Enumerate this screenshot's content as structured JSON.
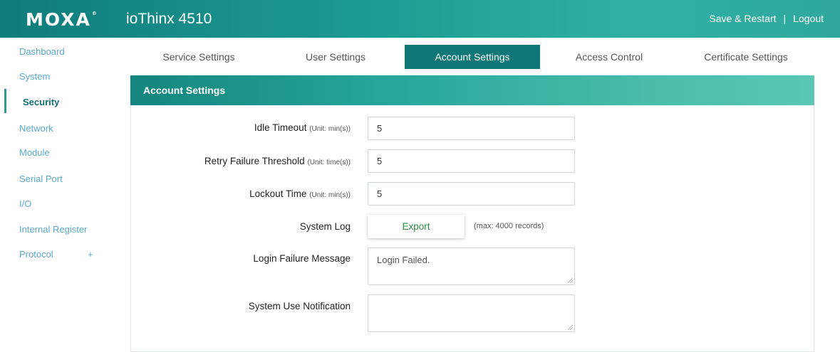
{
  "header": {
    "brand": "MOXA",
    "product": "ioThinx 4510",
    "save_restart": "Save & Restart",
    "separator": "|",
    "logout": "Logout"
  },
  "sidebar": {
    "items": [
      {
        "label": "Dashboard"
      },
      {
        "label": "System"
      },
      {
        "label": "Security"
      },
      {
        "label": "Network"
      },
      {
        "label": "Module"
      },
      {
        "label": "Serial Port"
      },
      {
        "label": "I/O"
      },
      {
        "label": "Internal Register"
      },
      {
        "label": "Protocol"
      }
    ],
    "active": "Security",
    "expand_symbol": "+"
  },
  "tabs": [
    {
      "label": "Service Settings"
    },
    {
      "label": "User Settings"
    },
    {
      "label": "Account Settings"
    },
    {
      "label": "Access Control"
    },
    {
      "label": "Certificate Settings"
    }
  ],
  "active_tab": "Account Settings",
  "panel": {
    "title": "Account Settings",
    "fields": {
      "idle_timeout": {
        "label": "Idle Timeout",
        "unit": "(Unit: min(s))",
        "value": "5"
      },
      "retry_threshold": {
        "label": "Retry Failure Threshold",
        "unit": "(Unit: time(s))",
        "value": "5"
      },
      "lockout_time": {
        "label": "Lockout Time",
        "unit": "(Unit: min(s))",
        "value": "5"
      },
      "system_log": {
        "label": "System Log",
        "button": "Export",
        "hint": "(max: 4000 records)"
      },
      "login_failure": {
        "label": "Login Failure Message",
        "value": "Login Failed."
      },
      "system_use": {
        "label": "System Use Notification",
        "value": ""
      }
    }
  },
  "colors": {
    "accent": "#0f7778",
    "sidebar_link": "#5aa9c9",
    "export_text": "#2b8a3e"
  }
}
